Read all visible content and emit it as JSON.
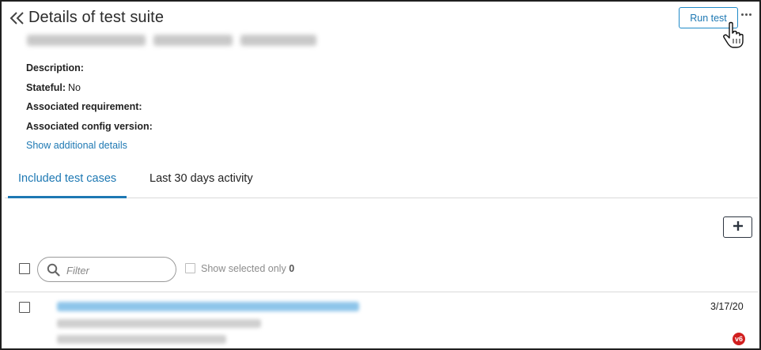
{
  "header": {
    "title": "Details of test suite",
    "subtitle_obscured": "ATT (2) Automation  p4fa8092ab ... 226487659f22",
    "run_button_label": "Run test"
  },
  "details": {
    "description_label": "Description:",
    "description_value": "",
    "stateful_label": "Stateful:",
    "stateful_value": "No",
    "requirement_label": "Associated requirement:",
    "requirement_value": "",
    "config_label": "Associated config version:",
    "config_value": "",
    "show_more_link": "Show additional details"
  },
  "tabs": [
    {
      "label": "Included test cases",
      "active": true
    },
    {
      "label": "Last 30 days activity",
      "active": false
    }
  ],
  "toolbar": {
    "filter_placeholder": "Filter",
    "show_selected_label": "Show selected only",
    "selected_count": "0"
  },
  "test_cases": [
    {
      "date": "3/17/20",
      "version_badge": "v6"
    }
  ],
  "icons": {
    "back": "double-chevron-left-icon",
    "more": "ellipsis-icon",
    "add": "plus-icon",
    "search": "search-icon",
    "cursor": "hand-pointer-icon"
  },
  "colors": {
    "accent": "#1d78b3",
    "badge": "#d11f1f",
    "border": "#1f1f1f"
  }
}
